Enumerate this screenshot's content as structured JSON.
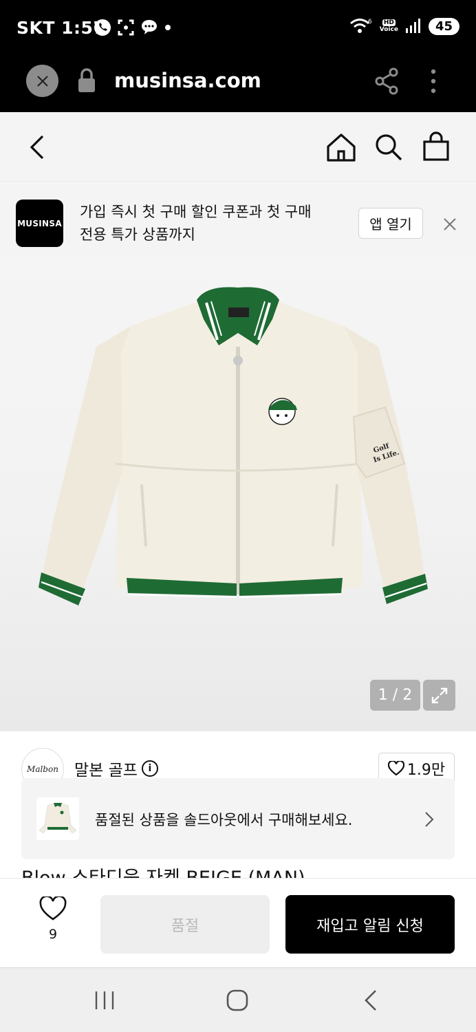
{
  "status_bar": {
    "carrier": "SKT",
    "time": "1:57",
    "network_badge": "6",
    "hd_badge": "HD",
    "voice_badge": "Voice",
    "battery": "45"
  },
  "browser": {
    "url": "musinsa.com"
  },
  "promo": {
    "logo_text": "MUSINSA",
    "line1": "가입 즉시 첫 구매 할인 쿠폰과 첫 구매",
    "line2": "전용 특가 상품까지",
    "open_app_label": "앱 열기"
  },
  "product_image": {
    "jacket_print": "Golf Is Life.",
    "pager": "1 / 2"
  },
  "product": {
    "brand_logo_text": "Malbon",
    "brand_name": "말본 골프",
    "brand_likes": "1.9만",
    "soldout_message": "품절된 상품을 솔드아웃에서 구매해보세요.",
    "title_partial": "Blow 스타디움 자켓 BEIGE (MAN)"
  },
  "actions": {
    "wish_count": "9",
    "soldout_label": "품절",
    "restock_label": "재입고 알림 신청"
  },
  "colors": {
    "jacket_body": "#f3eee2",
    "jacket_trim": "#1f6b34",
    "accent_black": "#000000"
  }
}
